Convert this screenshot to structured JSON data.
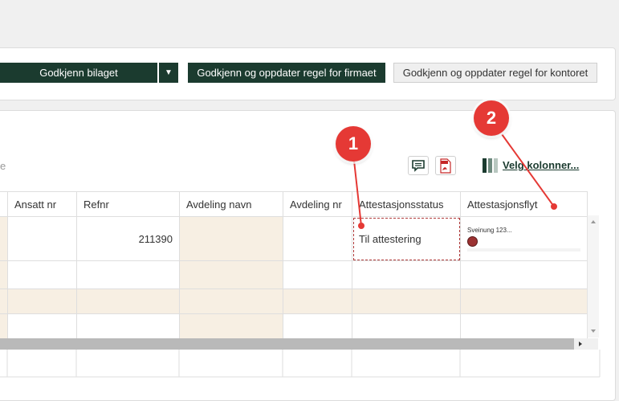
{
  "toolbar": {
    "approve_label": "Godkjenn bilaget",
    "caret": "▼",
    "approve_firm_label": "Godkjenn og oppdater regel for firmaet",
    "approve_office_label": "Godkjenn og oppdater regel for kontoret"
  },
  "grid_tools": {
    "fragment_text": "e",
    "choose_columns_label": "Velg kolonner..."
  },
  "table": {
    "headers": [
      "Ansatt nr",
      "Refnr",
      "Avdeling navn",
      "Avdeling nr",
      "Attestasjonsstatus",
      "Attestasjonsflyt"
    ],
    "rows": [
      {
        "ansatt_nr": "",
        "refnr": "211390",
        "avdeling_navn": "",
        "avdeling_nr": "",
        "status": "Til attestering",
        "flow_name": "Sveinung 123..."
      }
    ]
  },
  "annotations": {
    "marker1": "1",
    "marker2": "2"
  },
  "colors": {
    "primary": "#1b3b2f",
    "marker": "#e53935",
    "beige": "#f7efe3"
  }
}
